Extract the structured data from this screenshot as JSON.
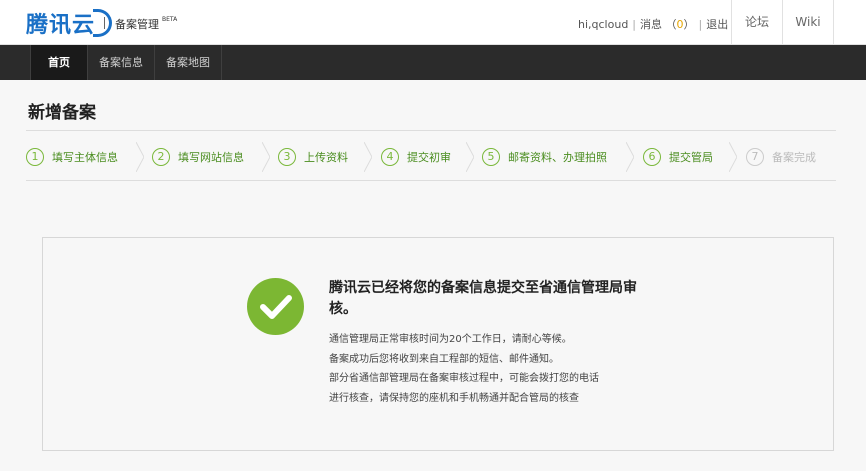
{
  "header": {
    "logo_text": "腾讯云",
    "subtitle": "备案管理",
    "beta": "BETA",
    "user": "hi,qcloud",
    "messages_label": "消息",
    "messages_count": "0",
    "logout": "退出",
    "forum": "论坛",
    "wiki": "Wiki"
  },
  "nav": {
    "items": [
      {
        "label": "首页"
      },
      {
        "label": "备案信息"
      },
      {
        "label": "备案地图"
      }
    ]
  },
  "page": {
    "title": "新增备案"
  },
  "steps": [
    {
      "num": "1",
      "label": "填写主体信息"
    },
    {
      "num": "2",
      "label": "填写网站信息"
    },
    {
      "num": "3",
      "label": "上传资料"
    },
    {
      "num": "4",
      "label": "提交初审"
    },
    {
      "num": "5",
      "label": "邮寄资料、办理拍照"
    },
    {
      "num": "6",
      "label": "提交管局"
    },
    {
      "num": "7",
      "label": "备案完成"
    }
  ],
  "result": {
    "title": "腾讯云已经将您的备案信息提交至省通信管理局审核。",
    "lines": [
      "通信管理局正常审核时间为20个工作日，请耐心等候。",
      "备案成功后您将收到来自工程部的短信、邮件通知。",
      "部分省通信部管理局在备案审核过程中，可能会拨打您的电话",
      "进行核查，请保持您的座机和手机畅通并配合管局的核查"
    ]
  },
  "colors": {
    "accent_green": "#7cb733",
    "brand_blue": "#1a70c6",
    "nav_bg": "#2b2b2b",
    "message_count": "#e5a500"
  }
}
